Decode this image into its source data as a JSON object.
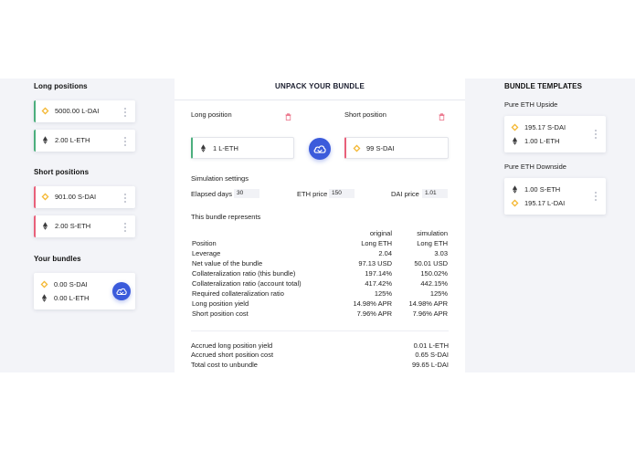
{
  "left": {
    "long_title": "Long positions",
    "long_items": [
      {
        "amount": "5000.00",
        "token": "L-DAI",
        "icon": "dai-icon"
      },
      {
        "amount": "2.00",
        "token": "L-ETH",
        "icon": "eth-icon"
      }
    ],
    "short_title": "Short positions",
    "short_items": [
      {
        "amount": "901.00",
        "token": "S-DAI",
        "icon": "dai-icon"
      },
      {
        "amount": "2.00",
        "token": "S-ETH",
        "icon": "eth-icon"
      }
    ],
    "bundles_title": "Your bundles",
    "bundle": [
      {
        "amount": "0.00",
        "token": "S-DAI",
        "icon": "dai-icon"
      },
      {
        "amount": "0.00",
        "token": "L-ETH",
        "icon": "eth-icon"
      }
    ]
  },
  "mid": {
    "title": "UNPACK YOUR BUNDLE",
    "long_label": "Long position",
    "short_label": "Short position",
    "long_box": {
      "amount": "1",
      "token": "L-ETH"
    },
    "short_box": {
      "amount": "99",
      "token": "S-DAI"
    },
    "sim_title": "Simulation settings",
    "elapsed_label": "Elapsed days",
    "elapsed_value": "30",
    "eth_price_label": "ETH price",
    "eth_price_value": "150",
    "dai_price_label": "DAI price",
    "dai_price_value": "1.01",
    "represents_title": "This bundle represents",
    "col_original": "original",
    "col_simulation": "simulation",
    "rows": [
      {
        "label": "Position",
        "original": "Long ETH",
        "simulation": "Long ETH"
      },
      {
        "label": "Leverage",
        "original": "2.04",
        "simulation": "3.03"
      },
      {
        "label": "Net value of the bundle",
        "original": "97.13 USD",
        "simulation": "50.01 USD"
      },
      {
        "label": "Collateralization ratio (this bundle)",
        "original": "197.14%",
        "simulation": "150.02%"
      },
      {
        "label": "Collateralization ratio (account total)",
        "original": "417.42%",
        "simulation": "442.15%"
      },
      {
        "label": "Required collateralization ratio",
        "original": "125%",
        "simulation": "125%"
      },
      {
        "label": "Long position yield",
        "original": "14.98% APR",
        "simulation": "14.98% APR"
      },
      {
        "label": "Short position cost",
        "original": "7.96% APR",
        "simulation": "7.96% APR"
      }
    ],
    "totals": [
      {
        "label": "Accrued long position yield",
        "value": "0.01 L-ETH"
      },
      {
        "label": "Accrued short position cost",
        "value": "0.65 S-DAI"
      },
      {
        "label": "Total cost to unbundle",
        "value": "99.65 L-DAI"
      }
    ]
  },
  "right": {
    "title": "BUNDLE TEMPLATES",
    "templates": [
      {
        "name": "Pure ETH Upside",
        "items": [
          {
            "amount": "195.17",
            "token": "S-DAI",
            "icon": "dai-icon"
          },
          {
            "amount": "1.00",
            "token": "L-ETH",
            "icon": "eth-icon"
          }
        ]
      },
      {
        "name": "Pure ETH Downside",
        "items": [
          {
            "amount": "1.00",
            "token": "S-ETH",
            "icon": "eth-icon"
          },
          {
            "amount": "195.17",
            "token": "L-DAI",
            "icon": "dai-icon"
          }
        ]
      }
    ]
  },
  "colors": {
    "accent": "#3b5bdb",
    "long": "#4caf7d",
    "short": "#e8607a",
    "dai": "#f4b731",
    "eth": "#3c3c3d"
  }
}
